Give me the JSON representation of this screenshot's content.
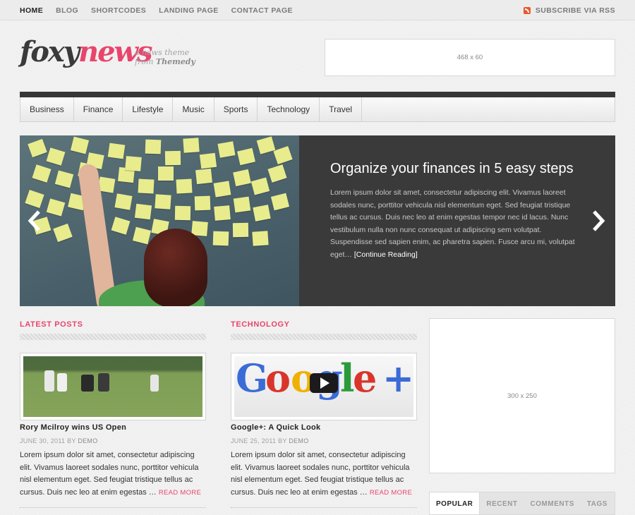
{
  "topbar": {
    "nav": [
      "HOME",
      "BLOG",
      "SHORTCODES",
      "LANDING PAGE",
      "CONTACT PAGE"
    ],
    "rss_label": "SUBSCRIBE VIA RSS"
  },
  "header": {
    "logo_part1": "foxy",
    "logo_part2": "news",
    "tagline_line1": "a news theme",
    "tagline_from": "from ",
    "tagline_brand": "Themedy",
    "ad_label": "468 x 60"
  },
  "categories": [
    "Business",
    "Finance",
    "Lifestyle",
    "Music",
    "Sports",
    "Technology",
    "Travel"
  ],
  "slider": {
    "title": "Organize your finances in 5 easy steps",
    "body": "Lorem ipsum dolor sit amet, consectetur adipiscing elit. Vivamus laoreet sodales nunc, porttitor vehicula nisl elementum eget. Sed feugiat tristique tellus ac cursus. Duis nec leo at enim egestas tempor nec id lacus. Nunc vestibulum nulla non nunc consequat ut adipiscing sem volutpat. Suspendisse sed sapien enim, ac pharetra sapien. Fusce arcu mi, volutpat eget… ",
    "more": "[Continue Reading]"
  },
  "latest": {
    "heading": "LATEST POSTS",
    "title": "Rory Mcilroy wins US Open",
    "date": "JUNE 30, 2011",
    "by": " BY ",
    "author": "DEMO",
    "excerpt": "Lorem ipsum dolor sit amet, consectetur adipiscing elit. Vivamus laoreet sodales nunc, porttitor vehicula nisl elementum eget. Sed feugiat tristique tellus ac cursus. Duis nec leo at enim egestas … ",
    "read_more": "READ MORE"
  },
  "technology": {
    "heading": "TECHNOLOGY",
    "title": "Google+: A Quick Look",
    "date": "JUNE 25, 2011",
    "by": " BY ",
    "author": "DEMO",
    "excerpt": "Lorem ipsum dolor sit amet, consectetur adipiscing elit. Vivamus laoreet sodales nunc, porttitor vehicula nisl elementum eget. Sed feugiat tristique tellus ac cursus. Duis nec leo at enim egestas … ",
    "read_more": "READ MORE",
    "image_text": [
      "G",
      "o",
      "o",
      "g",
      "l",
      "e",
      "+"
    ]
  },
  "sidebar": {
    "ad_label": "300 x 250",
    "tabs": [
      "POPULAR",
      "RECENT",
      "COMMENTS",
      "TAGS"
    ]
  },
  "colors": {
    "accent": "#e8456d",
    "dark": "#373737"
  },
  "icons": {
    "rss": "rss-icon",
    "prev": "chevron-left-icon",
    "next": "chevron-right-icon",
    "play": "play-icon"
  }
}
